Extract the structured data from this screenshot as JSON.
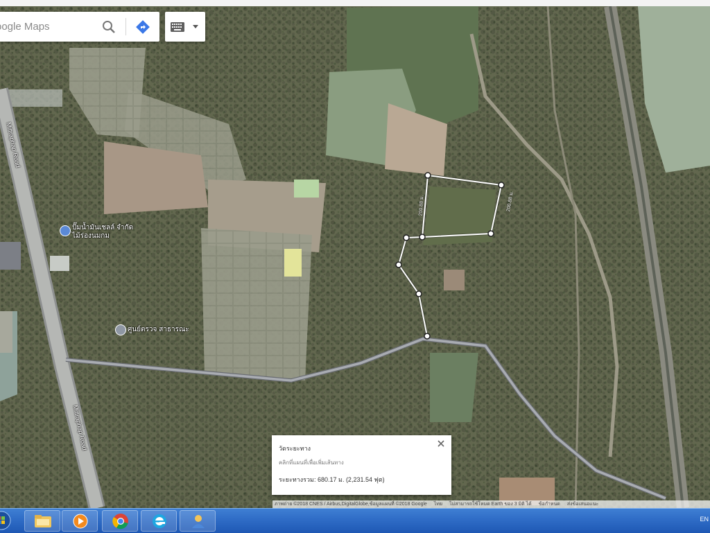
{
  "search": {
    "placeholder": "oogle Maps"
  },
  "map": {
    "labels": {
      "road_1": "Mittraphap Road",
      "road_2": "Mittraphap Road",
      "poi_1": "ปั๊มน้ำมันเชลล์ จำกัด\nไม้ร่องนมกม",
      "poi_2": "ศูนย์ตรวจ สาธารณะ"
    },
    "distance_labels": [
      "200.88 ม.",
      "200.88 ม."
    ]
  },
  "measure_panel": {
    "title": "วัดระยะทาง",
    "hint": "คลิกที่แผนที่เพื่อเพิ่มเส้นทาง",
    "total": "ระยะทางรวม: 680.17 ม. (2,231.54 ฟุต)"
  },
  "attribution": {
    "imagery": "ภาพถ่าย ©2018 CNES / Airbus,DigitalGlobe,ข้อมูลแผนที่ ©2018 Google",
    "region": "ไทย",
    "earth_promo": "ไม่สามารถใช้โหมด Earth ของ 3 มิติ ได้",
    "feedback": "ข้อกำหนด",
    "report": "ส่งข้อเสนอแนะ"
  },
  "taskbar": {
    "apps": [
      "explorer-icon",
      "media-player-icon",
      "chrome-icon",
      "ie-icon",
      "user-icon"
    ],
    "language": "EN"
  },
  "colors": {
    "measure_line": "#ffffff",
    "taskbar": "#2f6cc6",
    "poi_marker": "#5b8ad8"
  }
}
